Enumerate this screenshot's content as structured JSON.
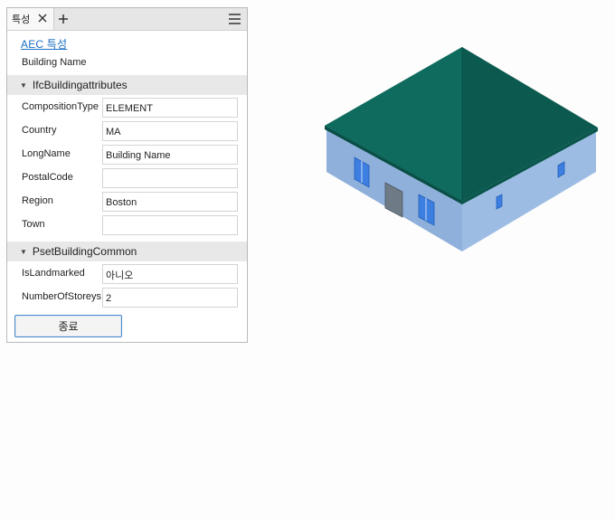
{
  "panel": {
    "tab_label": "특성",
    "link": "AEC 특성",
    "building_name": "Building Name",
    "sections": [
      {
        "title": "IfcBuildingattributes",
        "rows": [
          {
            "label": "CompositionType",
            "value": "ELEMENT"
          },
          {
            "label": "Country",
            "value": "MA"
          },
          {
            "label": "LongName",
            "value": "Building Name"
          },
          {
            "label": "PostalCode",
            "value": ""
          },
          {
            "label": "Region",
            "value": "Boston"
          },
          {
            "label": "Town",
            "value": ""
          }
        ]
      },
      {
        "title": "PsetBuildingCommon",
        "rows": [
          {
            "label": "IsLandmarked",
            "value": "아니오"
          },
          {
            "label": "NumberOfStoreys",
            "value": "2"
          }
        ]
      }
    ],
    "close_button": "종료"
  },
  "icons": {
    "tab_close": "close-icon",
    "tab_add": "plus-icon",
    "menu": "hamburger-menu-icon",
    "section_toggle": "collapse-arrow-icon"
  },
  "colors": {
    "roof": "#0f6b5e",
    "walls": "#8fb3de",
    "link": "#1a6fc2",
    "button_border": "#4a88c9"
  }
}
